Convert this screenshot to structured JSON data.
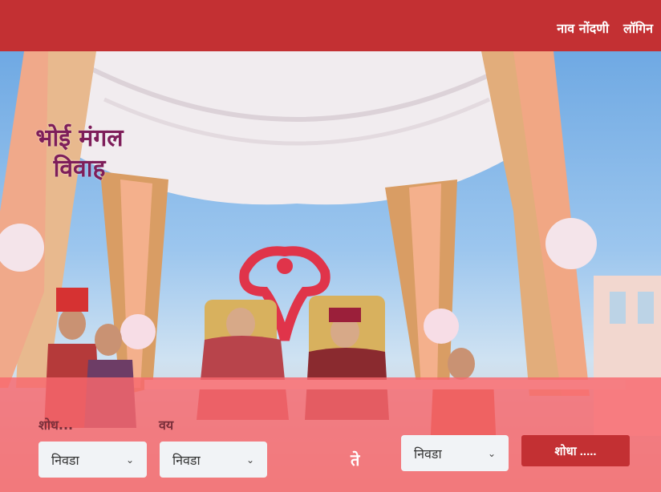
{
  "header": {
    "nav": [
      "नाव नोंदणी",
      "लॉगिन"
    ]
  },
  "logo": {
    "line1": "भोई मंगल",
    "line2": "विवाह"
  },
  "search": {
    "label_search": "शोध...",
    "label_age": "वय",
    "select1_value": "निवडा",
    "select2_value": "निवडा",
    "to_text": "ते",
    "select3_value": "निवडा",
    "button_label": "शोधा ....."
  },
  "colors": {
    "header_bg": "#c33033",
    "panel_bg": "#f8686e",
    "logo_text": "#7e1e5a"
  }
}
